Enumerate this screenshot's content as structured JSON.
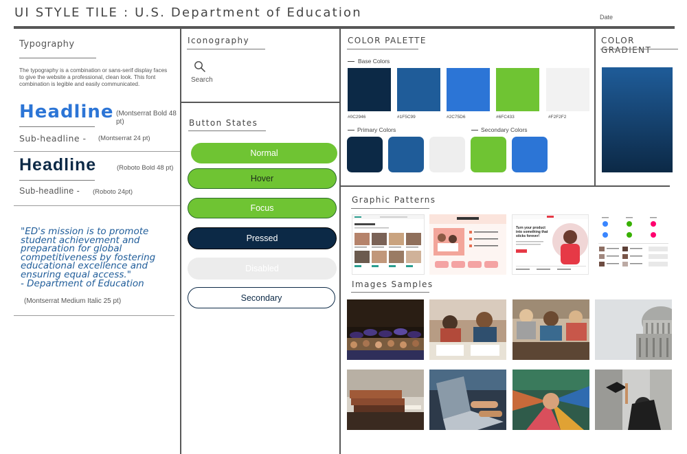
{
  "header": {
    "title": "UI STYLE TILE : U.S. Department of Education",
    "date_label": "Date"
  },
  "typography": {
    "title": "Typography",
    "description": "The typography is a combination or sans-serif display faces to give the website a professional, clean look. This font combination is legible and easily communicated.",
    "headline_montserrat": "Headline",
    "headline_montserrat_note": "(Montserrat Bold 48 pt)",
    "subheadline_montserrat": "Sub-headline -",
    "subheadline_montserrat_note": "(Montserrat 24 pt)",
    "headline_roboto": "Headline",
    "headline_roboto_note": "(Roboto Bold 48 pt)",
    "subheadline_roboto": "Sub-headline -",
    "subheadline_roboto_note": "(Roboto 24pt)",
    "quote_lines": [
      "\"ED's mission is to promote",
      "student achievement and",
      "preparation for global",
      "competitiveness by fostering",
      "educational excellence and",
      "ensuring equal access.\"",
      "- Department of Education"
    ],
    "quote_note": "(Montserrat Medium Italic 25 pt)"
  },
  "iconography": {
    "title": "Iconography",
    "search_icon": "search-icon",
    "search_label": "Search"
  },
  "buttons": {
    "title": "Button States",
    "normal": "Normal",
    "hover": "Hover",
    "focus": "Focus",
    "pressed": "Pressed",
    "disabled": "Disabled",
    "secondary": "Secondary"
  },
  "palette": {
    "title": "COLOR PALETTE",
    "base_label": "Base Colors",
    "base_colors": [
      {
        "hex": "#0C2946",
        "color": "#0c2946"
      },
      {
        "hex": "#1F5C99",
        "color": "#1f5c99"
      },
      {
        "hex": "#2C75D6",
        "color": "#2c75d6"
      },
      {
        "hex": "#6FC433",
        "color": "#6fc433"
      },
      {
        "hex": "#F2F2F2",
        "color": "#f2f2f2"
      }
    ],
    "primary_label": "Primary Colors",
    "primary_colors": [
      "#0c2946",
      "#1f5c99",
      "#eeeeee"
    ],
    "secondary_label": "Secondary Colors",
    "secondary_colors": [
      "#6fc433",
      "#2c75d6"
    ]
  },
  "gradient": {
    "title": "COLOR GRADIENT",
    "start": "#1f5c99",
    "end": "#0c2946"
  },
  "patterns": {
    "title": "Graphic Patterns",
    "tile2_lines": [
      "Turn your product",
      "into something that",
      "sticks forever!"
    ]
  },
  "images": {
    "title": "Images Samples",
    "items": [
      "graduation-photo",
      "students-writing-photo",
      "students-group-photo",
      "capitol-dome-photo",
      "books-photo",
      "laptop-photo",
      "hands-together-photo",
      "graduate-cap-photo"
    ]
  }
}
